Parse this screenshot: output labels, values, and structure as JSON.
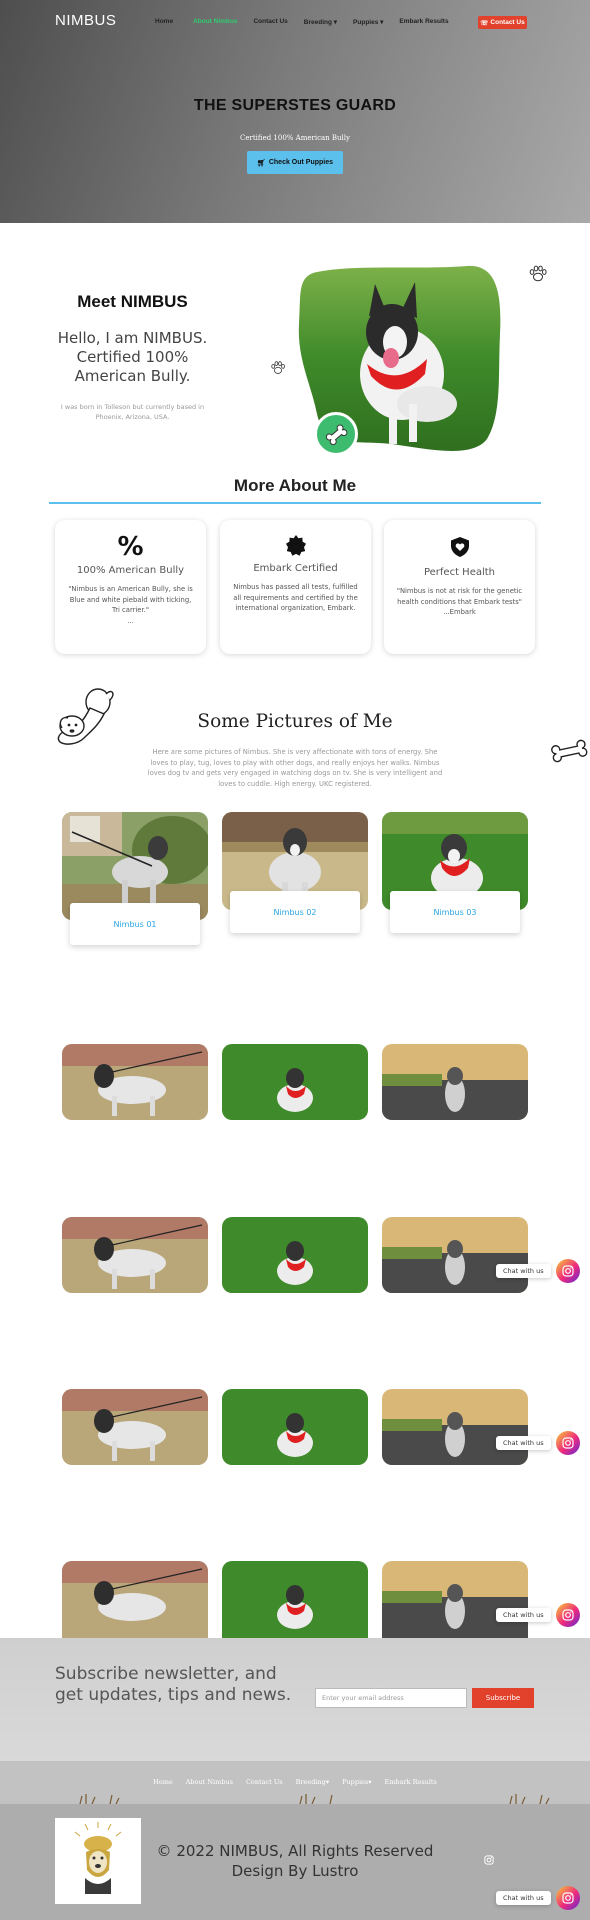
{
  "brand": "NIMBUS",
  "nav": {
    "items": [
      "Home",
      "About Nimbus",
      "Contact Us",
      "Breeding",
      "Puppies",
      "Embark Results"
    ],
    "contact_button": "Contact Us"
  },
  "hero": {
    "title": "THE SUPERSTES GUARD",
    "subtitle": "Certified 100% American Bully",
    "button": "Check Out Puppies"
  },
  "meet": {
    "title": "Meet NIMBUS",
    "lead": "Hello, I am NIMBUS. Certified 100% American Bully.",
    "text": "I was born in Tolleson but currently based in Phoenix, Arizona, USA."
  },
  "more_about": {
    "title": "More About Me",
    "cards": [
      {
        "icon": "percent-icon",
        "title": "100% American Bully",
        "text": "\"Nimbus is an American Bully, she is Blue and white piebald with ticking, Tri carrier.\"",
        "extra": "..."
      },
      {
        "icon": "badge-icon",
        "title": "Embark Certified",
        "text": "Nimbus has passed all tests, fulfilled all requirements and certified by the international organization, Embark.",
        "extra": ""
      },
      {
        "icon": "shield-heart-icon",
        "title": "Perfect Health",
        "text": "\"Nimbus is not at risk for the genetic health conditions that Embark tests\"",
        "extra": "...Embark"
      }
    ]
  },
  "pictures": {
    "title": "Some Pictures of Me",
    "description": "Here are some pictures of Nimbus. She is very affectionate with tons of energy. She loves to play, tug, loves to play with other dogs, and really enjoys her walks. Nimbus loves dog tv and gets very engaged in watching dogs on tv. She is very intelligent and loves to cuddle. High energy. UKC registered.",
    "labels": [
      "Nimbus 01",
      "Nimbus 02",
      "Nimbus 03"
    ]
  },
  "chat": {
    "label": "Chat with us"
  },
  "subscribe": {
    "text": "Subscribe newsletter, and get updates, tips and news.",
    "placeholder": "Enter your email address",
    "button": "Subscribe"
  },
  "footer": {
    "nav": [
      "Home",
      "About Nimbus",
      "Contact Us",
      "Breeding",
      "Puppies",
      "Embark Results"
    ],
    "copyright": "© 2022 NIMBUS, All Rights Reserved",
    "credit": "Design By Lustro"
  },
  "colors": {
    "accent": "#5bc0eb",
    "green": "#2ecc71",
    "red": "#e2412b",
    "link_blue": "#2aa5e0"
  }
}
